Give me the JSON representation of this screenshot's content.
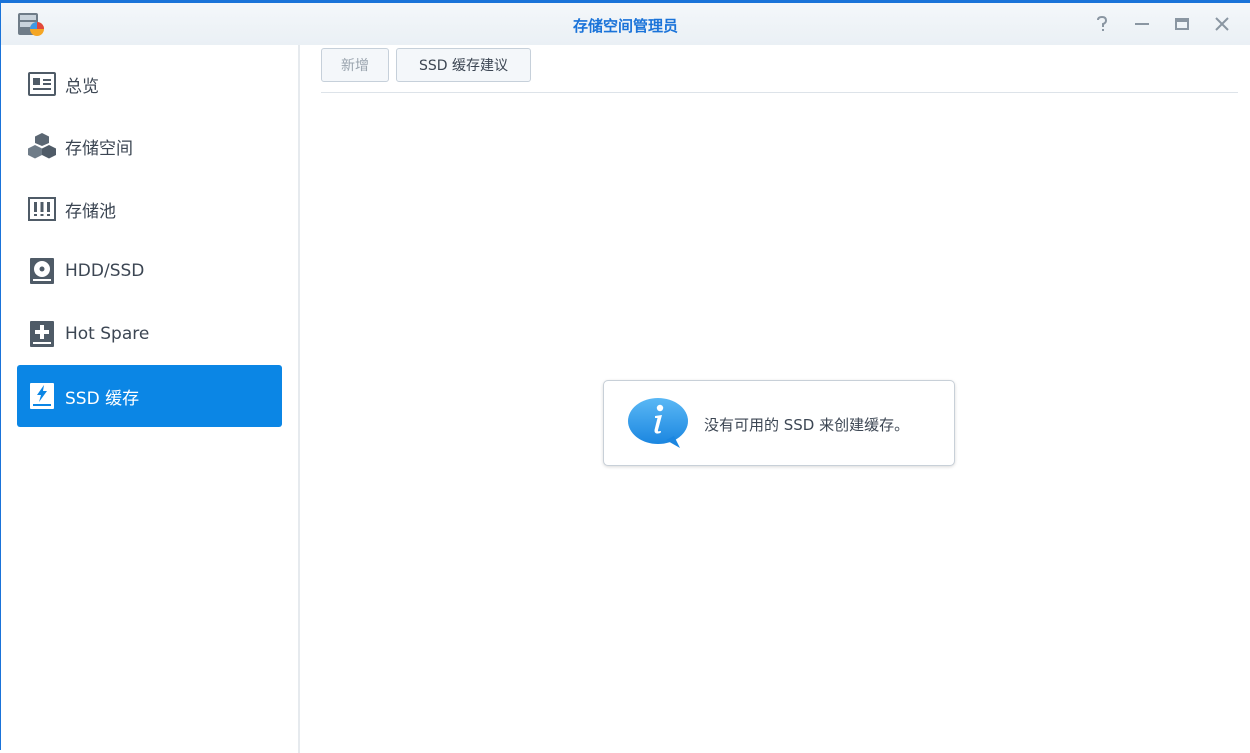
{
  "window": {
    "title": "存储空间管理员",
    "controls": [
      "help-icon",
      "minimize-icon",
      "maximize-icon",
      "close-icon"
    ]
  },
  "sidebar": {
    "items": [
      {
        "label": "总览",
        "icon": "overview-icon",
        "active": false
      },
      {
        "label": "存储空间",
        "icon": "volume-cubes-icon",
        "active": false
      },
      {
        "label": "存储池",
        "icon": "storage-pool-icon",
        "active": false
      },
      {
        "label": "HDD/SSD",
        "icon": "disk-icon",
        "active": false
      },
      {
        "label": "Hot Spare",
        "icon": "hot-spare-icon",
        "active": false
      },
      {
        "label": "SSD 缓存",
        "icon": "ssd-cache-icon",
        "active": true
      }
    ]
  },
  "toolbar": {
    "add_label": "新增",
    "advisor_label": "SSD 缓存建议"
  },
  "message": {
    "text": "没有可用的 SSD 来创建缓存。",
    "icon": "info-icon"
  },
  "colors": {
    "accent": "#0b86e5",
    "title": "#1a73d9",
    "text": "#3c4653"
  }
}
